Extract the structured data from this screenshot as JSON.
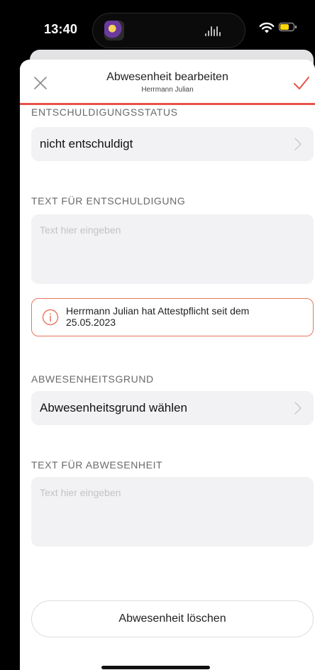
{
  "status_bar": {
    "time": "13:40"
  },
  "header": {
    "title": "Abwesenheit bearbeiten",
    "subtitle": "Herrmann Julian"
  },
  "excuse_status": {
    "label": "ENTSCHULDIGUNGSSTATUS",
    "value": "nicht entschuldigt"
  },
  "excuse_text": {
    "label": "TEXT FÜR ENTSCHULDIGUNG",
    "placeholder": "Text hier eingeben"
  },
  "notice": {
    "text": "Herrmann Julian hat Attestpflicht seit dem 25.05.2023"
  },
  "absence_reason": {
    "label": "ABWESENHEITSGRUND",
    "value": "Abwesenheitsgrund wählen"
  },
  "absence_text": {
    "label": "TEXT FÜR ABWESENHEIT",
    "placeholder": "Text hier eingeben"
  },
  "delete_button": "Abwesenheit löschen",
  "colors": {
    "accent": "#e8524a",
    "notice_border": "#e8765c",
    "field_bg": "#f2f2f4"
  }
}
